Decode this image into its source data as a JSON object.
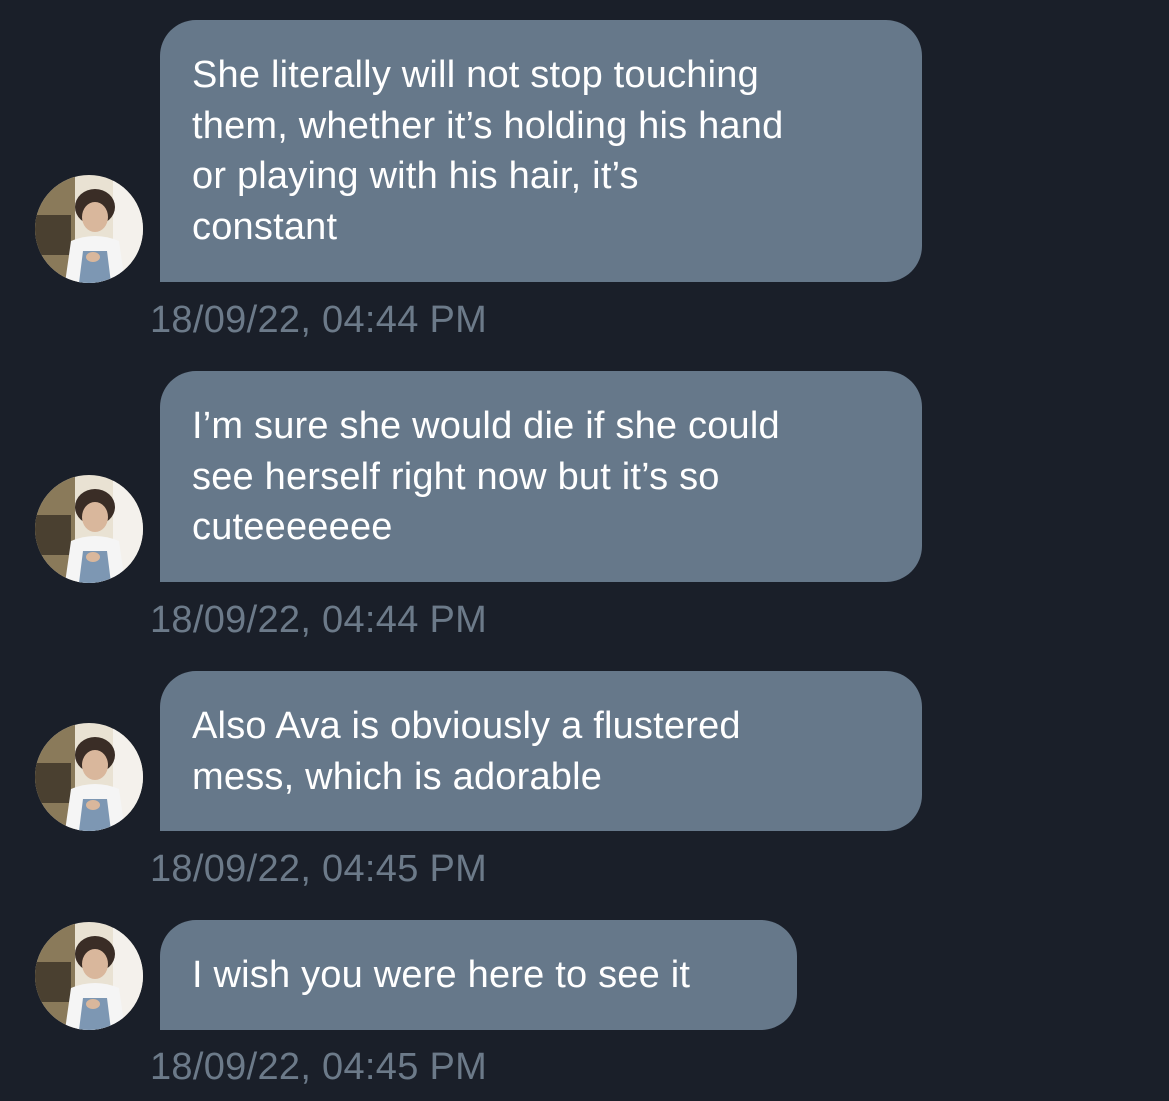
{
  "conversation": {
    "messages": [
      {
        "text": "She literally will not stop touching\nthem, whether it’s holding his hand\nor playing with his hair, it’s\nconstant",
        "timestamp": "18/09/22, 04:44 PM"
      },
      {
        "text": "I’m sure she would die if she could\nsee herself right now but it’s so\ncuteeeeeee",
        "timestamp": "18/09/22, 04:44 PM"
      },
      {
        "text": "Also Ava is obviously a flustered\nmess, which is adorable",
        "timestamp": "18/09/22, 04:45 PM"
      },
      {
        "text": "I wish you were here to see it",
        "timestamp": "18/09/22, 04:45 PM"
      }
    ]
  },
  "colors": {
    "background": "#1a1f29",
    "bubble": "#66788a",
    "bubble_text": "#ffffff",
    "timestamp": "#6c7a89"
  }
}
